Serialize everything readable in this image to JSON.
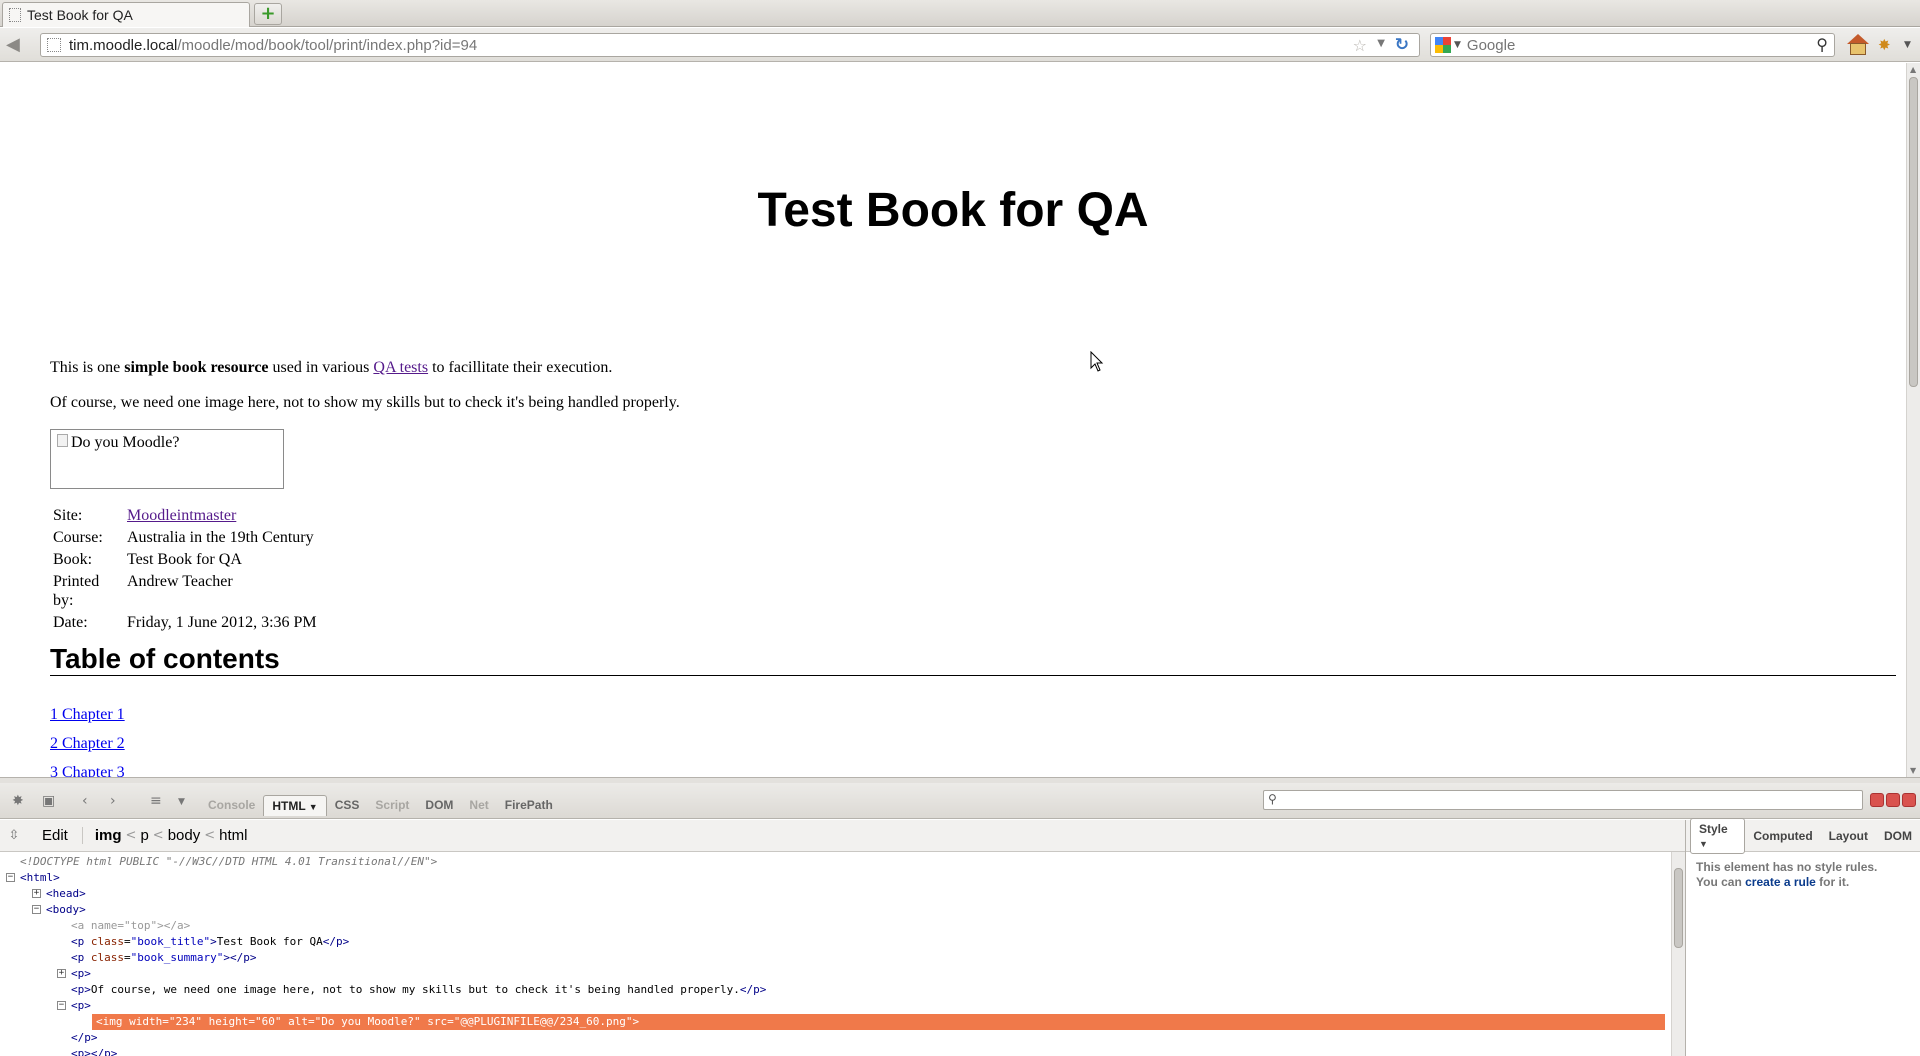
{
  "browser": {
    "tab_title": "Test Book for QA",
    "url_host": "tim.moodle.local",
    "url_path": "/moodle/mod/book/tool/print/index.php?id=94",
    "search_placeholder": "Google"
  },
  "page": {
    "title": "Test Book for QA",
    "summary": {
      "pre": "This is one ",
      "bold": "simple book resource",
      "mid": " used in various ",
      "link": "QA tests",
      "post": " to facillitate their execution."
    },
    "paragraph2": "Of course, we need one image here, not to show my skills but to check it's being handled properly.",
    "image_alt": "Do you Moodle?",
    "info": [
      {
        "label": "Site:",
        "value": "Moodleintmaster",
        "link": true
      },
      {
        "label": "Course:",
        "value": "Australia in the 19th Century"
      },
      {
        "label": "Book:",
        "value": "Test Book for QA"
      },
      {
        "label": "Printed by:",
        "value": "Andrew Teacher"
      },
      {
        "label": "Date:",
        "value": "Friday, 1 June 2012, 3:36 PM"
      }
    ],
    "toc_title": "Table of contents",
    "toc": [
      "1 Chapter 1",
      "2 Chapter 2",
      "3 Chapter 3"
    ]
  },
  "firebug": {
    "tabs": [
      "Console",
      "HTML",
      "CSS",
      "Script",
      "DOM",
      "Net",
      "FirePath"
    ],
    "edit_label": "Edit",
    "crumbs": [
      "img",
      "p",
      "body",
      "html"
    ],
    "side_tabs": [
      "Style",
      "Computed",
      "Layout",
      "DOM"
    ],
    "side_msg_1": "This element has no style rules.",
    "side_msg_2_pre": "You can ",
    "side_msg_link": "create a rule",
    "side_msg_2_post": " for it.",
    "html_lines": {
      "doctype": "<!DOCTYPE html PUBLIC \"-//W3C//DTD HTML 4.01 Transitional//EN\">",
      "p_text": "Of course, we need one image here, not to show my skills but to check it's being handled properly.",
      "book_title_text": "Test Book for QA",
      "img_width": "234",
      "img_height": "60",
      "img_alt": "Do you Moodle?",
      "img_src": "@@PLUGINFILE@@/234_60.png"
    }
  }
}
